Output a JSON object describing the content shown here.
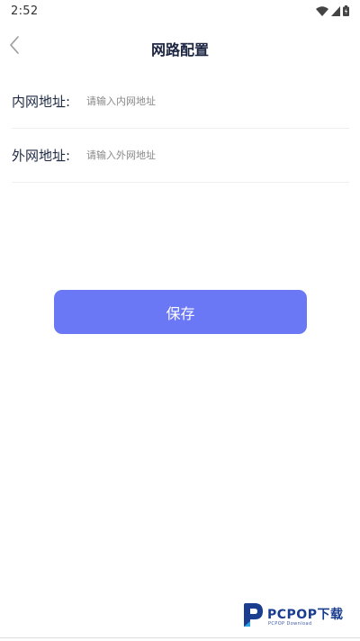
{
  "status_bar": {
    "time": "2:52",
    "icons": [
      "wifi-icon",
      "cellular-signal-icon",
      "battery-charging-icon"
    ]
  },
  "header": {
    "title": "网路配置",
    "back_icon": "chevron-left-icon"
  },
  "form": {
    "intranet": {
      "label": "内网地址:",
      "placeholder": "请输入内网地址",
      "value": ""
    },
    "extranet": {
      "label": "外网地址:",
      "placeholder": "请输入外网地址",
      "value": ""
    }
  },
  "actions": {
    "save_label": "保存"
  },
  "watermark": {
    "logo_icon": "pcpop-logo-icon",
    "text": "PCPOP下载",
    "subtext": "PCPOP Download"
  },
  "colors": {
    "primary": "#6a78f5",
    "title_text": "#1c2541",
    "label_text": "#1e2a44",
    "placeholder_text": "#888888",
    "divider": "#eeeeee",
    "watermark": "#1a3d8f"
  }
}
